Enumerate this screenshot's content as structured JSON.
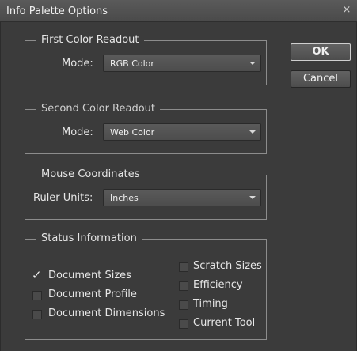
{
  "window": {
    "title": "Info Palette Options",
    "close_glyph": "×"
  },
  "first_readout": {
    "legend": "First Color Readout",
    "mode_label": "Mode:",
    "mode_value": "RGB Color"
  },
  "second_readout": {
    "legend": "Second Color Readout",
    "mode_label": "Mode:",
    "mode_value": "Web Color"
  },
  "mouse_coords": {
    "legend": "Mouse Coordinates",
    "units_label": "Ruler Units:",
    "units_value": "Inches"
  },
  "buttons": {
    "ok": "OK",
    "cancel": "Cancel"
  },
  "status": {
    "legend": "Status Information",
    "left": [
      {
        "label": "Document Sizes",
        "checked": true
      },
      {
        "label": "Document Profile",
        "checked": false
      },
      {
        "label": "Document Dimensions",
        "checked": false
      }
    ],
    "right": [
      {
        "label": "Scratch Sizes",
        "checked": false
      },
      {
        "label": "Efficiency",
        "checked": false
      },
      {
        "label": "Timing",
        "checked": false
      },
      {
        "label": "Current Tool",
        "checked": false
      }
    ]
  }
}
